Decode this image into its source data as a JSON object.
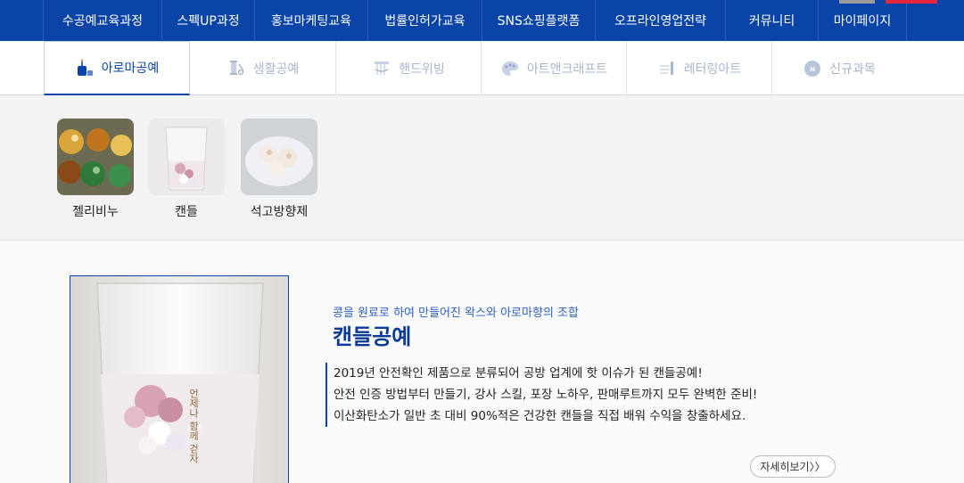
{
  "topnav": {
    "items": [
      {
        "label": "수공예교육과정"
      },
      {
        "label": "스펙UP과정"
      },
      {
        "label": "홍보마케팅교육"
      },
      {
        "label": "법률인허가교육"
      },
      {
        "label": "SNS쇼핑플랫폼"
      },
      {
        "label": "오프라인영업전략"
      },
      {
        "label": "커뮤니티"
      },
      {
        "label": "마이페이지"
      }
    ]
  },
  "subtabs": {
    "items": [
      {
        "label": "아로마공예",
        "icon": "candle-icon",
        "active": true
      },
      {
        "label": "생활공예",
        "icon": "sewing-icon",
        "active": false
      },
      {
        "label": "핸드위빙",
        "icon": "weaving-icon",
        "active": false
      },
      {
        "label": "아트앤크래프트",
        "icon": "palette-icon",
        "active": false
      },
      {
        "label": "레터링아트",
        "icon": "pen-icon",
        "active": false
      },
      {
        "label": "신규과목",
        "icon": "new-badge-icon",
        "active": false
      }
    ]
  },
  "categories": {
    "items": [
      {
        "label": "젤리비누"
      },
      {
        "label": "캔들"
      },
      {
        "label": "석고방향제"
      }
    ]
  },
  "detail": {
    "subtitle": "콩을 원료로 하여 만들어진 왁스와 아로마향의 조합",
    "title": "캔들공예",
    "desc_lines": [
      "2019년 안전확인 제품으로 분류되어 공방 업계에 핫 이슈가 된 캔들공예!",
      "안전 인증 방법부터 만들기, 강사 스킬, 포장 노하우, 판매루트까지 모두 완벽한 준비!",
      "이산화탄소가 일반 초 대비 90%적은 건강한 캔들을 직접 배워 수익을 창출하세요."
    ],
    "more_label": "자세히보기〉〉",
    "image_caption": "언제나 함께 걷자"
  },
  "colors": {
    "brand_blue": "#0a44a8",
    "accent_text": "#2d62c0"
  }
}
